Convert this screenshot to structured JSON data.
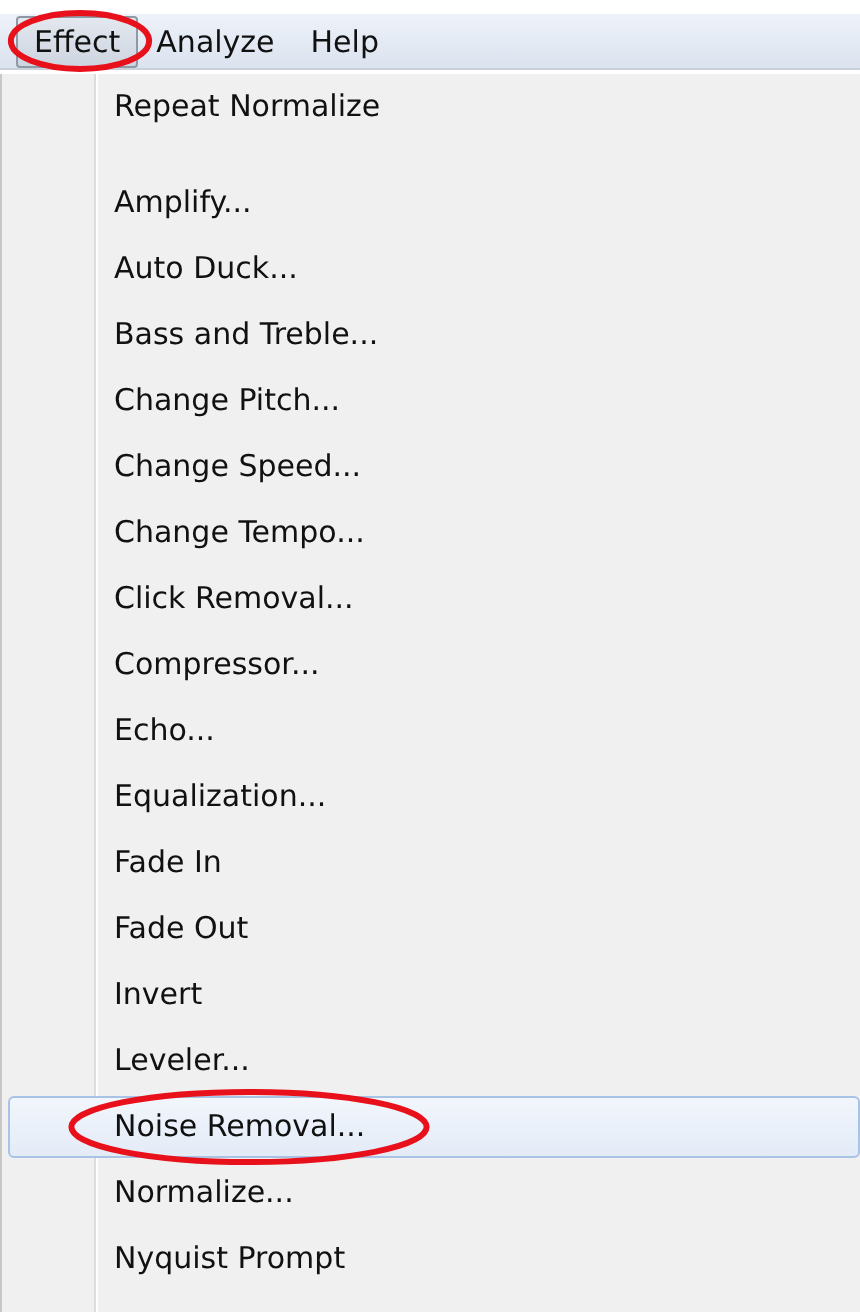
{
  "menu_bar": [
    {
      "label": "Effect",
      "selected": true,
      "circled": true
    },
    {
      "label": "Analyze",
      "selected": false,
      "circled": false
    },
    {
      "label": "Help",
      "selected": false,
      "circled": false
    }
  ],
  "menu": {
    "items": [
      {
        "kind": "command",
        "label": "Repeat Normalize",
        "selected": false,
        "circled": false
      },
      {
        "kind": "separator"
      },
      {
        "kind": "command",
        "label": "Amplify...",
        "selected": false,
        "circled": false
      },
      {
        "kind": "command",
        "label": "Auto Duck...",
        "selected": false,
        "circled": false
      },
      {
        "kind": "command",
        "label": "Bass and Treble...",
        "selected": false,
        "circled": false
      },
      {
        "kind": "command",
        "label": "Change Pitch...",
        "selected": false,
        "circled": false
      },
      {
        "kind": "command",
        "label": "Change Speed...",
        "selected": false,
        "circled": false
      },
      {
        "kind": "command",
        "label": "Change Tempo...",
        "selected": false,
        "circled": false
      },
      {
        "kind": "command",
        "label": "Click Removal...",
        "selected": false,
        "circled": false
      },
      {
        "kind": "command",
        "label": "Compressor...",
        "selected": false,
        "circled": false
      },
      {
        "kind": "command",
        "label": "Echo...",
        "selected": false,
        "circled": false
      },
      {
        "kind": "command",
        "label": "Equalization...",
        "selected": false,
        "circled": false
      },
      {
        "kind": "command",
        "label": "Fade In",
        "selected": false,
        "circled": false
      },
      {
        "kind": "command",
        "label": "Fade Out",
        "selected": false,
        "circled": false
      },
      {
        "kind": "command",
        "label": "Invert",
        "selected": false,
        "circled": false
      },
      {
        "kind": "command",
        "label": "Leveler...",
        "selected": false,
        "circled": false
      },
      {
        "kind": "command",
        "label": "Noise Removal...",
        "selected": true,
        "circled": true
      },
      {
        "kind": "command",
        "label": "Normalize...",
        "selected": false,
        "circled": false
      },
      {
        "kind": "command",
        "label": "Nyquist Prompt",
        "selected": false,
        "circled": false
      }
    ]
  }
}
